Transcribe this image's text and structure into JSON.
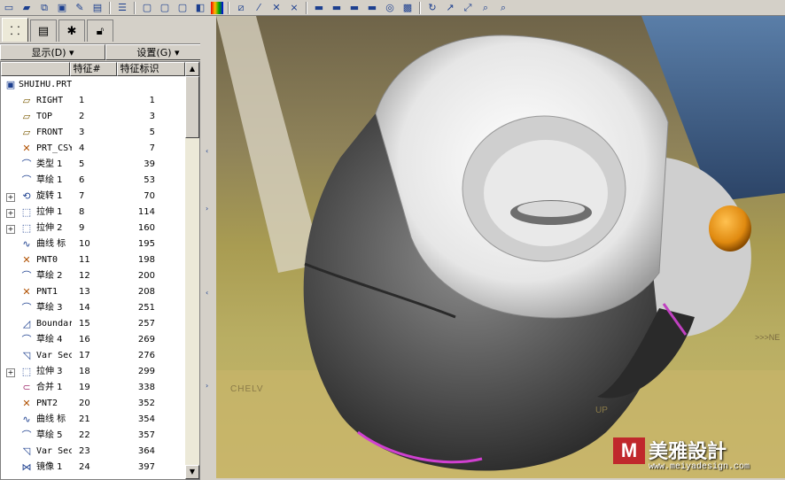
{
  "toolbar": {
    "icons": [
      "new-file-icon",
      "open-folder-icon",
      "merge-icon",
      "save-icon",
      "edit-icon",
      "print-icon",
      "tree-icon",
      "window-icon",
      "window2-icon",
      "window3-icon",
      "shading-icon",
      "color-icon",
      "datum-planes-icon",
      "datum-axes-icon",
      "datum-points-icon",
      "datum-csys-icon",
      "view-icon1",
      "view-icon2",
      "view-icon3",
      "view-icon4",
      "render-icon",
      "appearance-icon",
      "spin-icon",
      "zoom-in-icon",
      "zoom-out-icon",
      "refit-icon"
    ]
  },
  "side_panel": {
    "tabs": [
      "model-tree-tab",
      "layers-tab",
      "star-tab",
      "lock-tab"
    ],
    "menu": {
      "show_label": "显示(D)",
      "settings_label": "设置(G)"
    },
    "columns": {
      "feature_num": "特征#",
      "feature_id": "特征标识"
    },
    "root": {
      "name": "SHUIHU.PRT"
    },
    "rows": [
      {
        "name": "RIGHT",
        "num": "1",
        "id": "1",
        "icon": "datum-plane-icon",
        "expand": false
      },
      {
        "name": "TOP",
        "num": "2",
        "id": "3",
        "icon": "datum-plane-icon",
        "expand": false
      },
      {
        "name": "FRONT",
        "num": "3",
        "id": "5",
        "icon": "datum-plane-icon",
        "expand": false
      },
      {
        "name": "PRT_CSYS",
        "num": "4",
        "id": "7",
        "icon": "csys-icon",
        "expand": false
      },
      {
        "name": "类型 1",
        "num": "5",
        "id": "39",
        "icon": "sketch-icon",
        "expand": false
      },
      {
        "name": "草绘 1",
        "num": "6",
        "id": "53",
        "icon": "sketch-icon",
        "expand": false
      },
      {
        "name": "旋转 1",
        "num": "7",
        "id": "70",
        "icon": "revolve-icon",
        "expand": true
      },
      {
        "name": "拉伸 1",
        "num": "8",
        "id": "114",
        "icon": "extrude-icon",
        "expand": true
      },
      {
        "name": "拉伸 2",
        "num": "9",
        "id": "160",
        "icon": "extrude-icon",
        "expand": true
      },
      {
        "name": "曲线 标",
        "num": "10",
        "id": "195",
        "icon": "curve-icon",
        "expand": false
      },
      {
        "name": "PNT0",
        "num": "11",
        "id": "198",
        "icon": "datum-point-icon",
        "expand": false
      },
      {
        "name": "草绘 2",
        "num": "12",
        "id": "200",
        "icon": "sketch-icon",
        "expand": false
      },
      {
        "name": "PNT1",
        "num": "13",
        "id": "208",
        "icon": "datum-point-icon",
        "expand": false
      },
      {
        "name": "草绘 3",
        "num": "14",
        "id": "251",
        "icon": "sketch-icon",
        "expand": false
      },
      {
        "name": "Boundary",
        "num": "15",
        "id": "257",
        "icon": "boundary-icon",
        "expand": false
      },
      {
        "name": "草绘 4",
        "num": "16",
        "id": "269",
        "icon": "sketch-icon",
        "expand": false
      },
      {
        "name": "Var Sec",
        "num": "17",
        "id": "276",
        "icon": "var-sec-icon",
        "expand": false
      },
      {
        "name": "拉伸 3",
        "num": "18",
        "id": "299",
        "icon": "extrude-icon",
        "expand": true
      },
      {
        "name": "合并 1",
        "num": "19",
        "id": "338",
        "icon": "merge-icon",
        "expand": false
      },
      {
        "name": "PNT2",
        "num": "20",
        "id": "352",
        "icon": "datum-point-icon",
        "expand": false
      },
      {
        "name": "曲线 标",
        "num": "21",
        "id": "354",
        "icon": "curve-icon",
        "expand": false
      },
      {
        "name": "草绘 5",
        "num": "22",
        "id": "357",
        "icon": "sketch-icon",
        "expand": false
      },
      {
        "name": "Var Sec",
        "num": "23",
        "id": "364",
        "icon": "var-sec-icon",
        "expand": false
      },
      {
        "name": "镜像 1",
        "num": "24",
        "id": "397",
        "icon": "mirror-icon",
        "expand": false
      }
    ]
  },
  "viewport": {
    "background_text": {
      "chelv": "CHELV",
      "up": "UP",
      "arrows": ">>>NE"
    },
    "watermark": {
      "brand": "美雅設計",
      "url": "www.meiyadesign.com"
    }
  },
  "colors": {
    "button_orange": "#e08a10",
    "body_gray": "#5a5a5a",
    "accent_blue": "#1c3f8f"
  }
}
